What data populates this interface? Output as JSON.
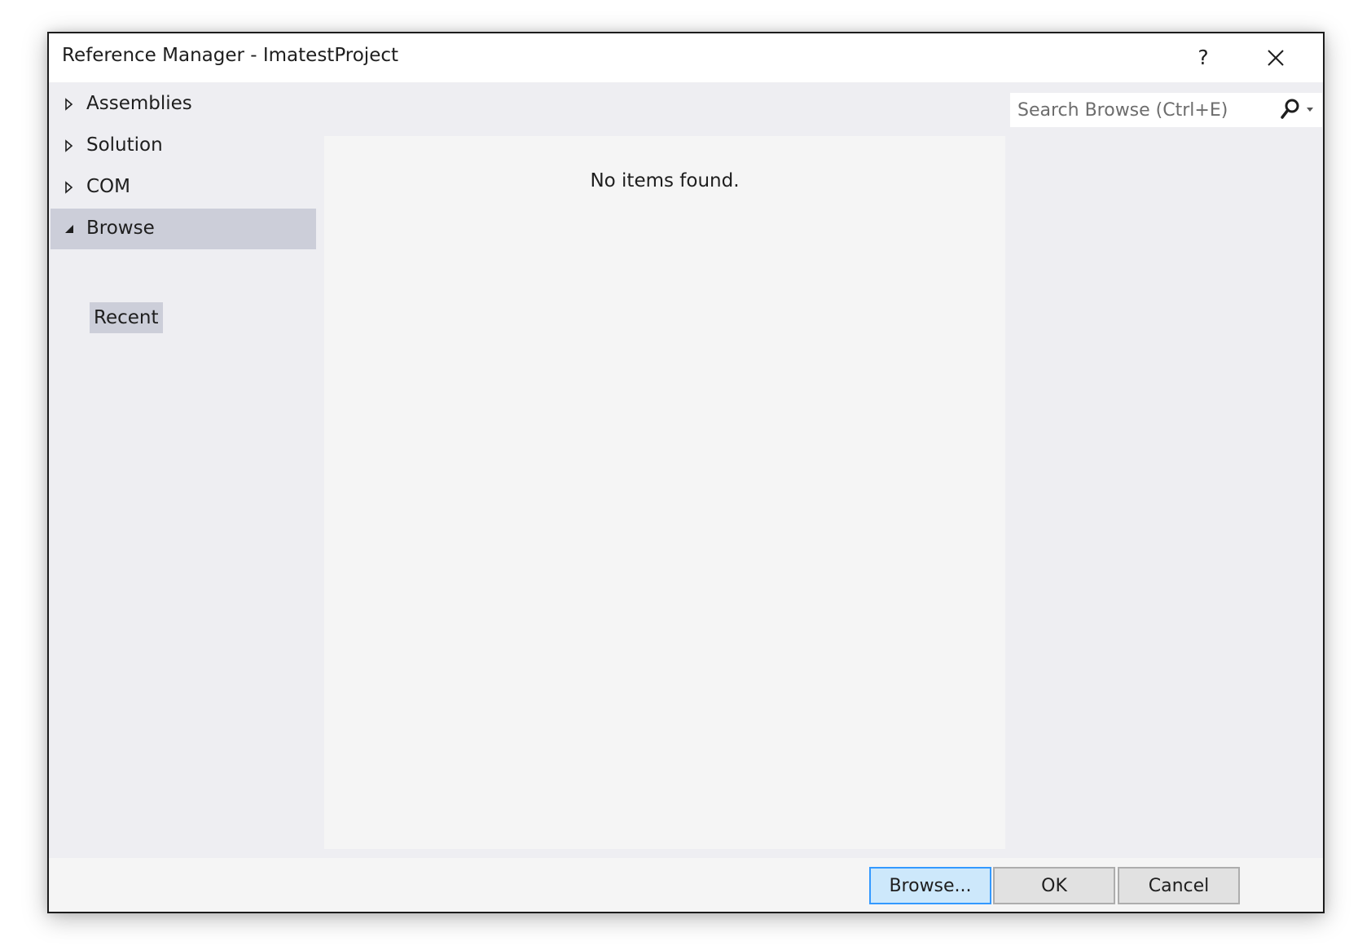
{
  "window": {
    "title": "Reference Manager - ImatestProject",
    "help_label": "?",
    "close_icon": "close-icon"
  },
  "sidebar": {
    "items": [
      {
        "label": "Assemblies",
        "expanded": false,
        "selected": false
      },
      {
        "label": "Solution",
        "expanded": false,
        "selected": false
      },
      {
        "label": "COM",
        "expanded": false,
        "selected": false
      },
      {
        "label": "Browse",
        "expanded": true,
        "selected": true
      }
    ],
    "subitems": [
      {
        "label": "Recent"
      }
    ]
  },
  "main": {
    "empty_message": "No items found."
  },
  "search": {
    "placeholder": "Search Browse (Ctrl+E)",
    "value": "",
    "icon": "search-icon"
  },
  "footer": {
    "browse_label": "Browse...",
    "ok_label": "OK",
    "cancel_label": "Cancel"
  },
  "colors": {
    "selection": "#ccced9",
    "dialog_bg": "#eeeef2",
    "content_bg": "#f5f5f5",
    "primary_border": "#3399ff"
  }
}
